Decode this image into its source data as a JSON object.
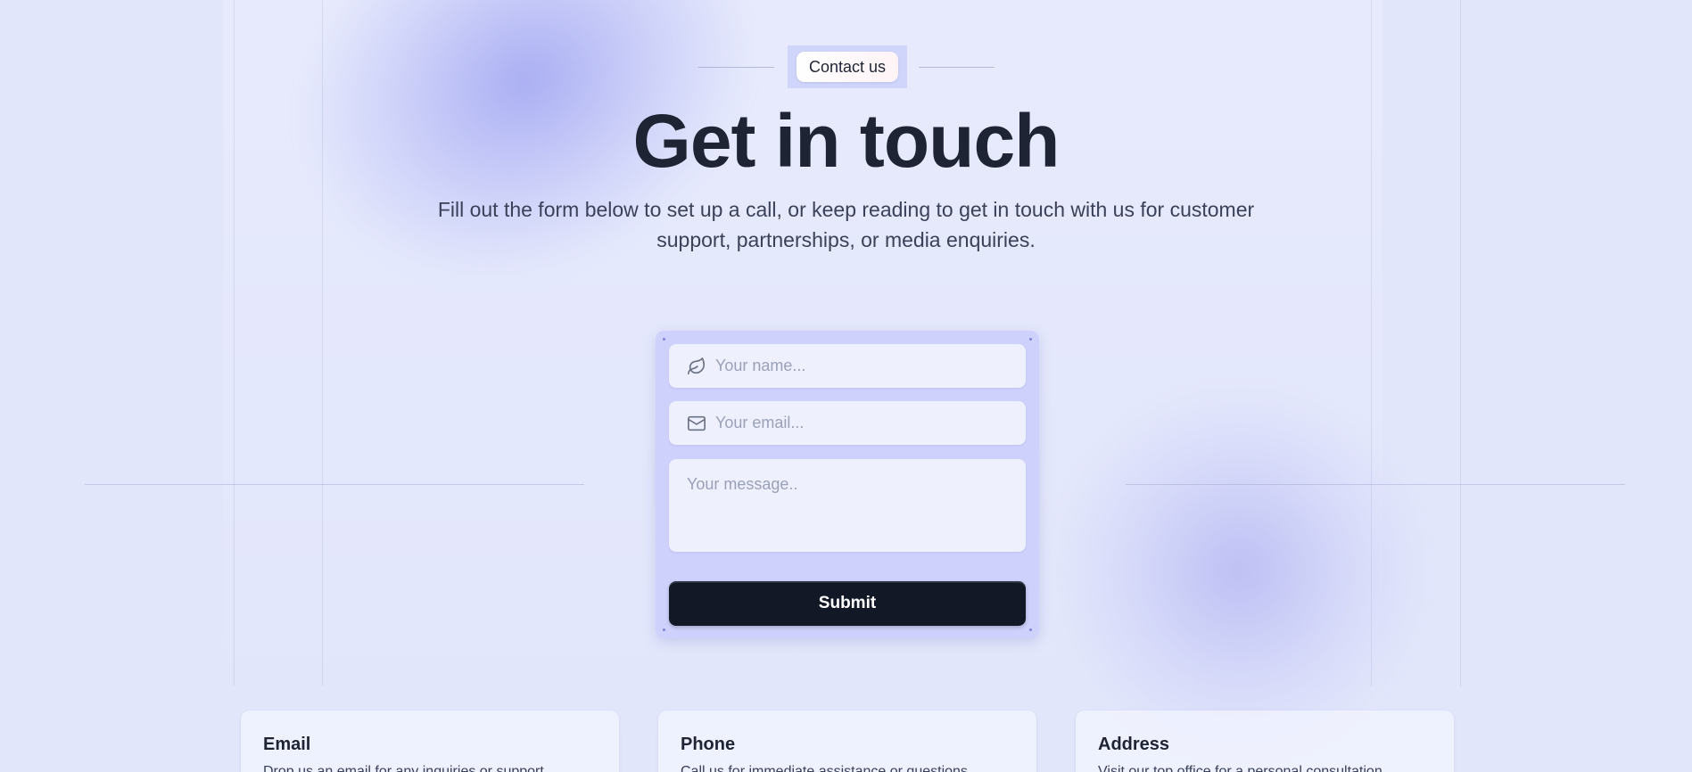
{
  "badge": {
    "label": "Contact us"
  },
  "hero": {
    "title": "Get in touch",
    "subtitle_line1": "Fill out the form below to set up a call, or keep reading to get in touch with us for customer",
    "subtitle_line2": "support, partnerships, or media enquiries."
  },
  "form": {
    "name_placeholder": "Your name...",
    "email_placeholder": "Your email...",
    "message_placeholder": "Your message..",
    "submit_label": "Submit",
    "name_icon": "leaf-icon",
    "email_icon": "mail-icon"
  },
  "info_cards": [
    {
      "title": "Email",
      "text": "Drop us an email for any inquiries or support"
    },
    {
      "title": "Phone",
      "text": "Call us for immediate assistance or questions"
    },
    {
      "title": "Address",
      "text": "Visit our top office for a personal consultation"
    }
  ],
  "colors": {
    "background": "#e2e6fb",
    "form_card": "#cdd1fb",
    "submit_button": "#121826",
    "title_text": "#1e2433"
  }
}
